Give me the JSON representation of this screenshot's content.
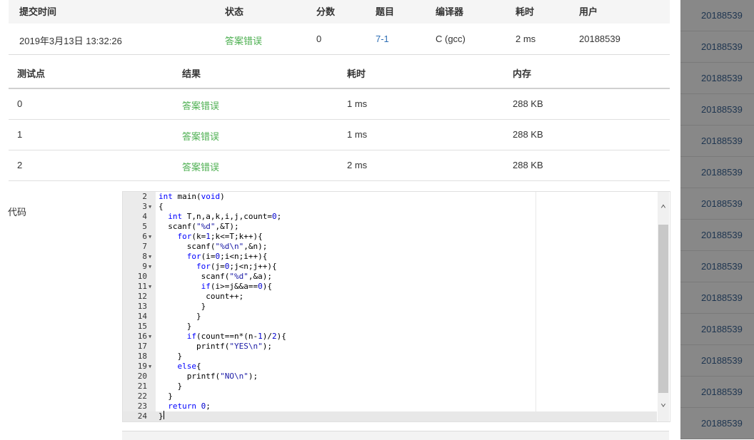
{
  "submission": {
    "headers": {
      "time": "提交时间",
      "status": "状态",
      "score": "分数",
      "problem": "题目",
      "compiler": "编译器",
      "time_used": "耗时",
      "user": "用户"
    },
    "row": {
      "time": "2019年3月13日 13:32:26",
      "status": "答案错误",
      "score": "0",
      "problem": "7-1",
      "compiler": "C (gcc)",
      "time_used": "2 ms",
      "user": "20188539"
    }
  },
  "testpoints": {
    "headers": {
      "id": "测试点",
      "result": "结果",
      "time": "耗时",
      "memory": "内存"
    },
    "rows": [
      {
        "id": "0",
        "result": "答案错误",
        "time": "1 ms",
        "memory": "288 KB"
      },
      {
        "id": "1",
        "result": "答案错误",
        "time": "1 ms",
        "memory": "288 KB"
      },
      {
        "id": "2",
        "result": "答案错误",
        "time": "2 ms",
        "memory": "288 KB"
      }
    ]
  },
  "code_label": "代码",
  "editor": {
    "lines": [
      {
        "n": "2",
        "fold": false,
        "code": "int main(void)"
      },
      {
        "n": "3",
        "fold": true,
        "code": "{"
      },
      {
        "n": "4",
        "fold": false,
        "code": "  int T,n,a,k,i,j,count=0;"
      },
      {
        "n": "5",
        "fold": false,
        "code": "  scanf(\"%d\",&T);"
      },
      {
        "n": "6",
        "fold": true,
        "code": "    for(k=1;k<=T;k++){"
      },
      {
        "n": "7",
        "fold": false,
        "code": "      scanf(\"%d\\n\",&n);"
      },
      {
        "n": "8",
        "fold": true,
        "code": "      for(i=0;i<n;i++){"
      },
      {
        "n": "9",
        "fold": true,
        "code": "        for(j=0;j<n;j++){"
      },
      {
        "n": "10",
        "fold": false,
        "code": "         scanf(\"%d\",&a);"
      },
      {
        "n": "11",
        "fold": true,
        "code": "         if(i>=j&&a==0){"
      },
      {
        "n": "12",
        "fold": false,
        "code": "          count++;"
      },
      {
        "n": "13",
        "fold": false,
        "code": "         }"
      },
      {
        "n": "14",
        "fold": false,
        "code": "        }"
      },
      {
        "n": "15",
        "fold": false,
        "code": "      }"
      },
      {
        "n": "16",
        "fold": true,
        "code": "      if(count==n*(n-1)/2){"
      },
      {
        "n": "17",
        "fold": false,
        "code": "        printf(\"YES\\n\");"
      },
      {
        "n": "18",
        "fold": false,
        "code": "    }"
      },
      {
        "n": "19",
        "fold": true,
        "code": "    else{"
      },
      {
        "n": "20",
        "fold": false,
        "code": "      printf(\"NO\\n\");"
      },
      {
        "n": "21",
        "fold": false,
        "code": "    }"
      },
      {
        "n": "22",
        "fold": false,
        "code": "  }"
      },
      {
        "n": "23",
        "fold": false,
        "code": "  return 0;"
      },
      {
        "n": "24",
        "fold": false,
        "code": "}"
      }
    ],
    "active_line": "24"
  },
  "sidebar": {
    "items": [
      "20188539",
      "20188539",
      "20188539",
      "20188539",
      "20188539",
      "20188539",
      "20188539",
      "20188539",
      "20188539",
      "20188539",
      "20188539",
      "20188539",
      "20188539",
      "20188539"
    ]
  },
  "colors": {
    "status_error": "#4caf50",
    "link": "#2f6fb5",
    "overlay": "#888888",
    "sidebar_text": "#1e3550"
  },
  "icons": {
    "scroll_up": "chevron-up-icon",
    "scroll_down": "chevron-down-icon",
    "fold": "fold-triangle-icon"
  }
}
